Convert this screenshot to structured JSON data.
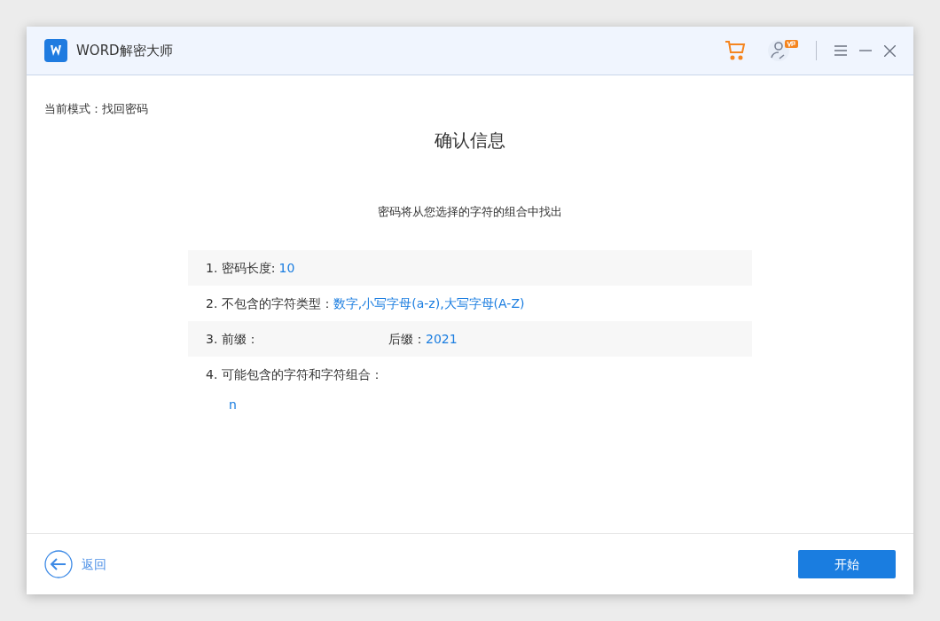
{
  "window": {
    "title": "WORD解密大师"
  },
  "mode": "当前模式：找回密码",
  "heading": "确认信息",
  "subtitle": "密码将从您选择的字符的组合中找出",
  "rows": [
    {
      "kind": "pair",
      "label": "1. 密码长度:",
      "value": "10"
    },
    {
      "kind": "pair",
      "label": "2. 不包含的字符类型：",
      "value": "数字,小写字母(a-z),大写字母(A-Z)"
    },
    {
      "kind": "split",
      "label": "3. 前缀：",
      "label2": "后缀：",
      "value": "2021"
    },
    {
      "kind": "pair",
      "label": "4. 可能包含的字符和字符组合："
    }
  ],
  "combinations": [
    "n"
  ],
  "footer": {
    "back": "返回",
    "start": "开始"
  }
}
